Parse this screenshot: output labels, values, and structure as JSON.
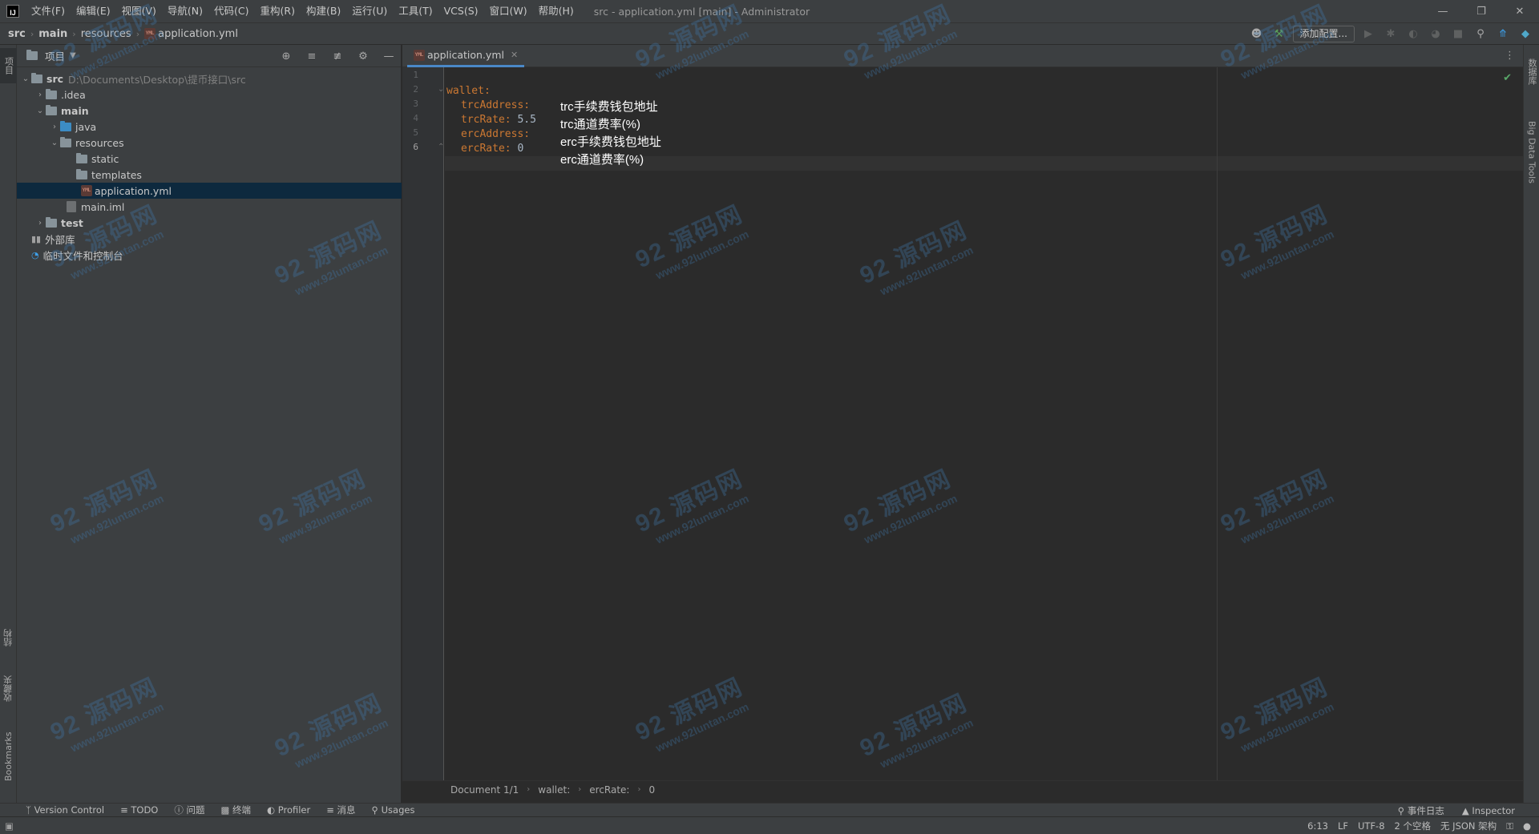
{
  "menu": {
    "items": [
      "文件(F)",
      "编辑(E)",
      "视图(V)",
      "导航(N)",
      "代码(C)",
      "重构(R)",
      "构建(B)",
      "运行(U)",
      "工具(T)",
      "VCS(S)",
      "窗口(W)",
      "帮助(H)"
    ],
    "window_title": "src - application.yml [main] - Administrator"
  },
  "breadcrumb": [
    "src",
    "main",
    "resources",
    "application.yml"
  ],
  "toolbar": {
    "config_label": "添加配置..."
  },
  "project_panel": {
    "title": "项目",
    "tree": [
      {
        "label": "src",
        "extra": "D:\\Documents\\Desktop\\提币接口\\src"
      },
      {
        "label": ".idea"
      },
      {
        "label": "main"
      },
      {
        "label": "java"
      },
      {
        "label": "resources"
      },
      {
        "label": "static"
      },
      {
        "label": "templates"
      },
      {
        "label": "application.yml"
      },
      {
        "label": "main.iml"
      },
      {
        "label": "test"
      },
      {
        "label": "外部库"
      },
      {
        "label": "临时文件和控制台"
      }
    ]
  },
  "editor": {
    "tab_label": "application.yml",
    "line_numbers": [
      "1",
      "2",
      "3",
      "4",
      "5",
      "6"
    ],
    "lines": [
      {
        "key": "",
        "value": ""
      },
      {
        "key": "wallet:",
        "value": ""
      },
      {
        "key": "trcAddress:",
        "value": ""
      },
      {
        "key": "trcRate:",
        "value": " 5.5"
      },
      {
        "key": "ercAddress:",
        "value": ""
      },
      {
        "key": "ercRate:",
        "value": " 0"
      }
    ],
    "annotations": [
      "trc手续费钱包地址",
      "trc通道费率(%)",
      "erc手续费钱包地址",
      "erc通道费率(%)"
    ],
    "breadcrumb": [
      "Document 1/1",
      "wallet:",
      "ercRate:",
      "0"
    ]
  },
  "left_strip": {
    "top": "项目",
    "structure": "结构",
    "favorites": "收藏夹",
    "bookmarks": "Bookmarks"
  },
  "right_strip": {
    "db": "数据库",
    "bigdata": "Big Data Tools"
  },
  "bottom_tools": [
    "Version Control",
    "TODO",
    "问题",
    "终端",
    "Profiler",
    "消息",
    "Usages"
  ],
  "bottom_right": [
    "事件日志",
    "Inspector"
  ],
  "status": {
    "position": "6:13",
    "line_sep": "LF",
    "encoding": "UTF-8",
    "indent": "2 个空格",
    "schema": "无 JSON 架构"
  },
  "watermark": {
    "brand": "92 源码网",
    "url": "www.92luntan.com"
  },
  "colors": {
    "key": "#cc7832",
    "value": "#a9b7c6",
    "selection": "#0d293e",
    "accent": "#4a88c7"
  }
}
